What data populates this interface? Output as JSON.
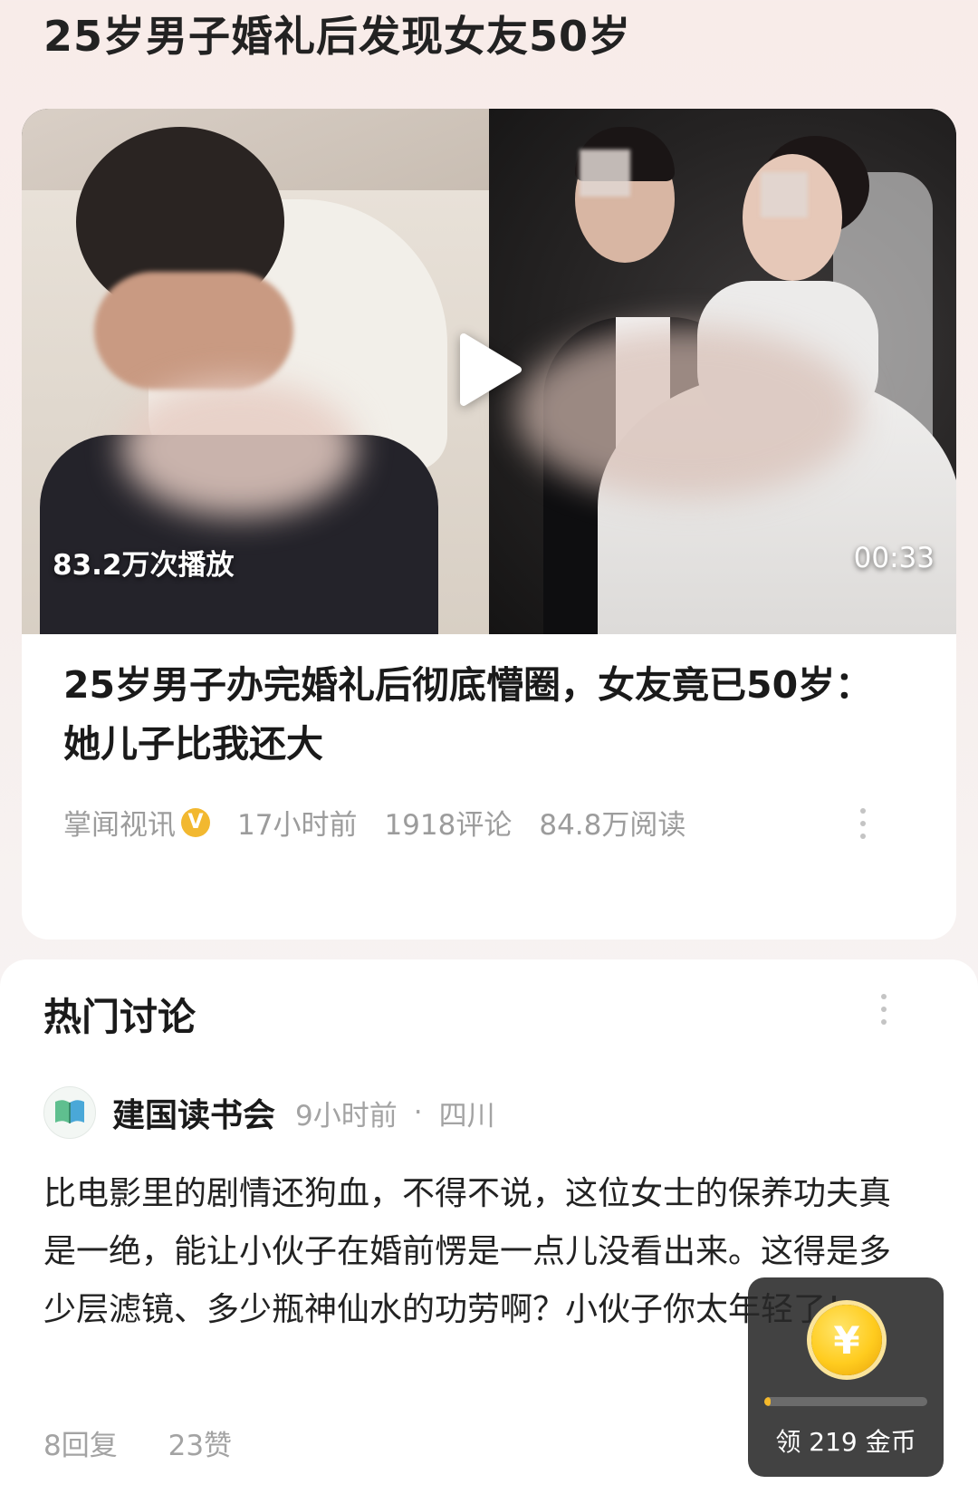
{
  "header": {
    "title": "25岁男子婚礼后发现女友50岁"
  },
  "video_card": {
    "views": "83.2万次播放",
    "duration": "00:33",
    "title": "25岁男子办完婚礼后彻底懵圈，女友竟已50岁：她儿子比我还大",
    "source": "掌闻视讯",
    "verified_badge": "V",
    "time": "17小时前",
    "comments": "1918评论",
    "reads": "84.8万阅读",
    "icons": {
      "play": "play-icon",
      "verified": "verified-badge-icon",
      "more": "more-vertical-icon"
    }
  },
  "discussion": {
    "title": "热门讨论",
    "comment": {
      "author": "建国读书会",
      "avatar_text": "建国读书会",
      "time": "9小时前",
      "separator": "·",
      "location": "四川",
      "text": "比电影里的剧情还狗血，不得不说，这位女士的保养功夫真是一绝，能让小伙子在婚前愣是一点儿没看出来。这得是多少层滤镜、多少瓶神仙水的功劳啊？小伙子你太年轻了！",
      "replies": "8回复",
      "likes": "23赞"
    }
  },
  "coin_widget": {
    "symbol": "¥",
    "label": "领 219 金币",
    "progress": 0.04,
    "colors": {
      "coin": "#ffcc1f",
      "fill": "#f5b92a"
    }
  }
}
